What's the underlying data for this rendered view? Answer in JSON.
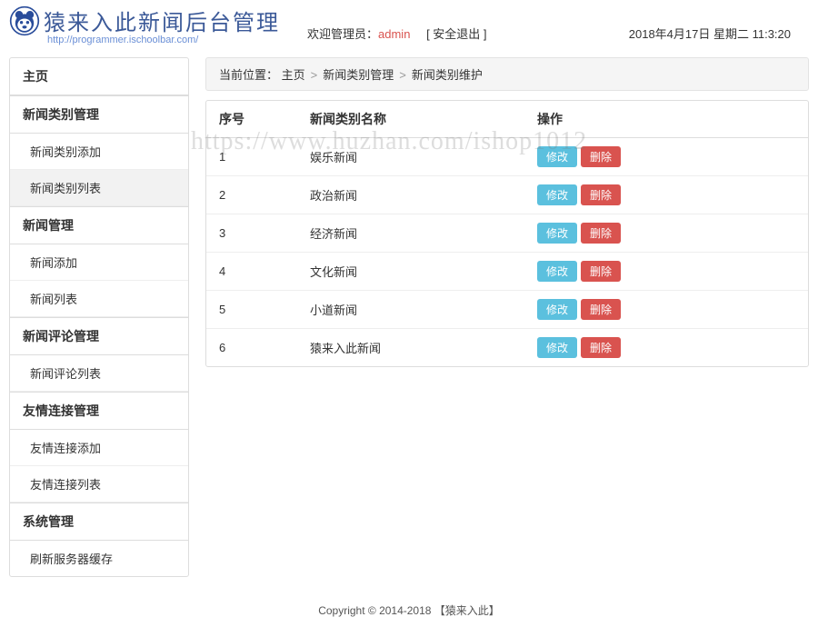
{
  "header": {
    "logo_title": "猿来入此新闻后台管理",
    "logo_sub": "http://programmer.ischoolbar.com/",
    "welcome_prefix": "欢迎管理员：",
    "admin_name": "admin",
    "logout_label": "[ 安全退出 ]",
    "datetime": "2018年4月17日 星期二 11:3:20"
  },
  "sidebar": {
    "groups": [
      {
        "title": "主页",
        "items": []
      },
      {
        "title": "新闻类别管理",
        "items": [
          {
            "label": "新闻类别添加",
            "active": false
          },
          {
            "label": "新闻类别列表",
            "active": true
          }
        ]
      },
      {
        "title": "新闻管理",
        "items": [
          {
            "label": "新闻添加",
            "active": false
          },
          {
            "label": "新闻列表",
            "active": false
          }
        ]
      },
      {
        "title": "新闻评论管理",
        "items": [
          {
            "label": "新闻评论列表",
            "active": false
          }
        ]
      },
      {
        "title": "友情连接管理",
        "items": [
          {
            "label": "友情连接添加",
            "active": false
          },
          {
            "label": "友情连接列表",
            "active": false
          }
        ]
      },
      {
        "title": "系统管理",
        "items": [
          {
            "label": "刷新服务器缓存",
            "active": false
          }
        ]
      }
    ]
  },
  "breadcrumb": {
    "prefix": "当前位置：",
    "items": [
      "主页",
      "新闻类别管理",
      "新闻类别维护"
    ]
  },
  "table": {
    "headers": {
      "seq": "序号",
      "name": "新闻类别名称",
      "ops": "操作"
    },
    "edit_label": "修改",
    "delete_label": "删除",
    "rows": [
      {
        "seq": "1",
        "name": "娱乐新闻"
      },
      {
        "seq": "2",
        "name": "政治新闻"
      },
      {
        "seq": "3",
        "name": "经济新闻"
      },
      {
        "seq": "4",
        "name": "文化新闻"
      },
      {
        "seq": "5",
        "name": "小道新闻"
      },
      {
        "seq": "6",
        "name": "猿来入此新闻"
      }
    ]
  },
  "footer": {
    "copyright": "Copyright © 2014-2018 【猿来入此】"
  },
  "watermark": "https://www.huzhan.com/ishop1012"
}
